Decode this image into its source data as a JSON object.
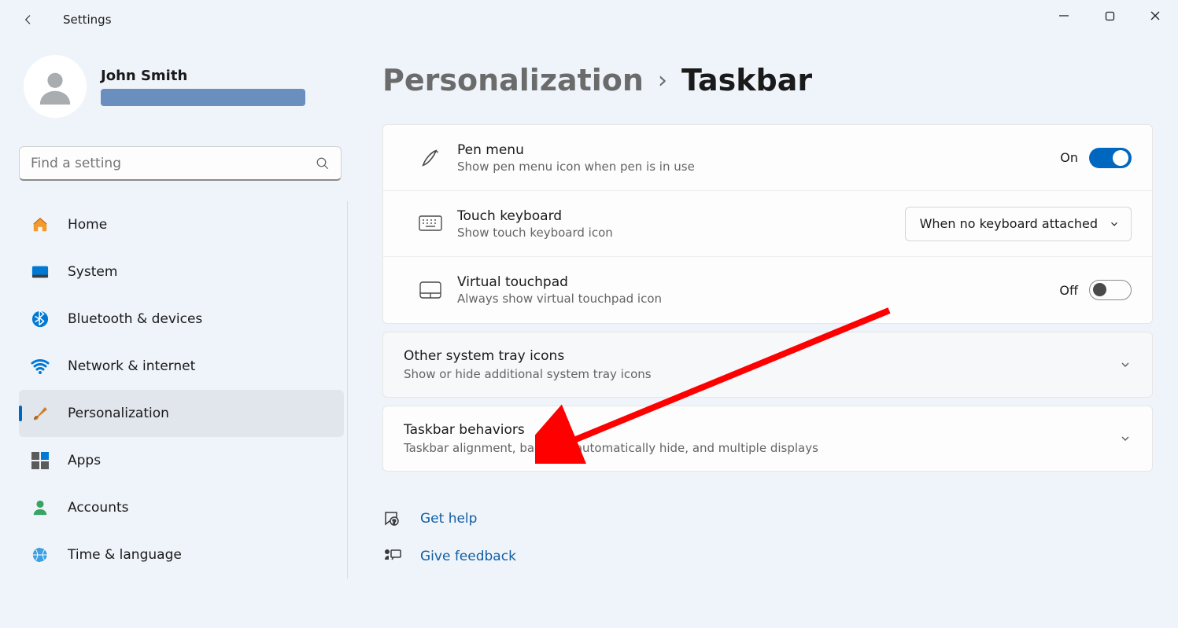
{
  "app": {
    "title": "Settings"
  },
  "user": {
    "name": "John Smith"
  },
  "search": {
    "placeholder": "Find a setting"
  },
  "nav": {
    "home": "Home",
    "system": "System",
    "bluetooth": "Bluetooth & devices",
    "network": "Network & internet",
    "personalization": "Personalization",
    "apps": "Apps",
    "accounts": "Accounts",
    "time": "Time & language"
  },
  "breadcrumb": {
    "parent": "Personalization",
    "current": "Taskbar"
  },
  "rows": {
    "pen": {
      "title": "Pen menu",
      "sub": "Show pen menu icon when pen is in use",
      "state": "On"
    },
    "touch": {
      "title": "Touch keyboard",
      "sub": "Show touch keyboard icon",
      "dropdown": "When no keyboard attached"
    },
    "vtouch": {
      "title": "Virtual touchpad",
      "sub": "Always show virtual touchpad icon",
      "state": "Off"
    }
  },
  "expanders": {
    "tray": {
      "title": "Other system tray icons",
      "sub": "Show or hide additional system tray icons"
    },
    "behaviors": {
      "title": "Taskbar behaviors",
      "sub": "Taskbar alignment, badging, automatically hide, and multiple displays"
    }
  },
  "links": {
    "help": "Get help",
    "feedback": "Give feedback"
  }
}
